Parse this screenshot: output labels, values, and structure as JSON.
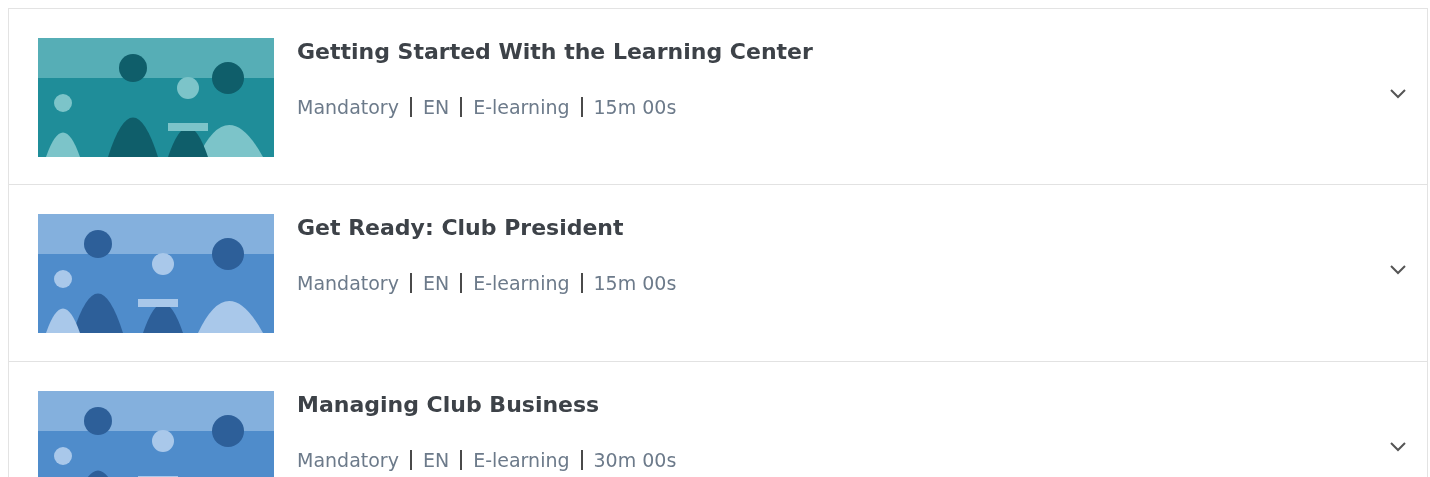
{
  "courses": [
    {
      "title": "Getting Started With the Learning Center",
      "meta": [
        "Mandatory",
        "EN",
        "E-learning",
        "15m 00s"
      ],
      "expanded": false
    },
    {
      "title": "Get Ready: Club President",
      "meta": [
        "Mandatory",
        "EN",
        "E-learning",
        "15m 00s"
      ],
      "expanded": false
    },
    {
      "title": "Managing Club Business",
      "meta": [
        "Mandatory",
        "EN",
        "E-learning",
        "30m 00s"
      ],
      "expanded": false
    }
  ]
}
